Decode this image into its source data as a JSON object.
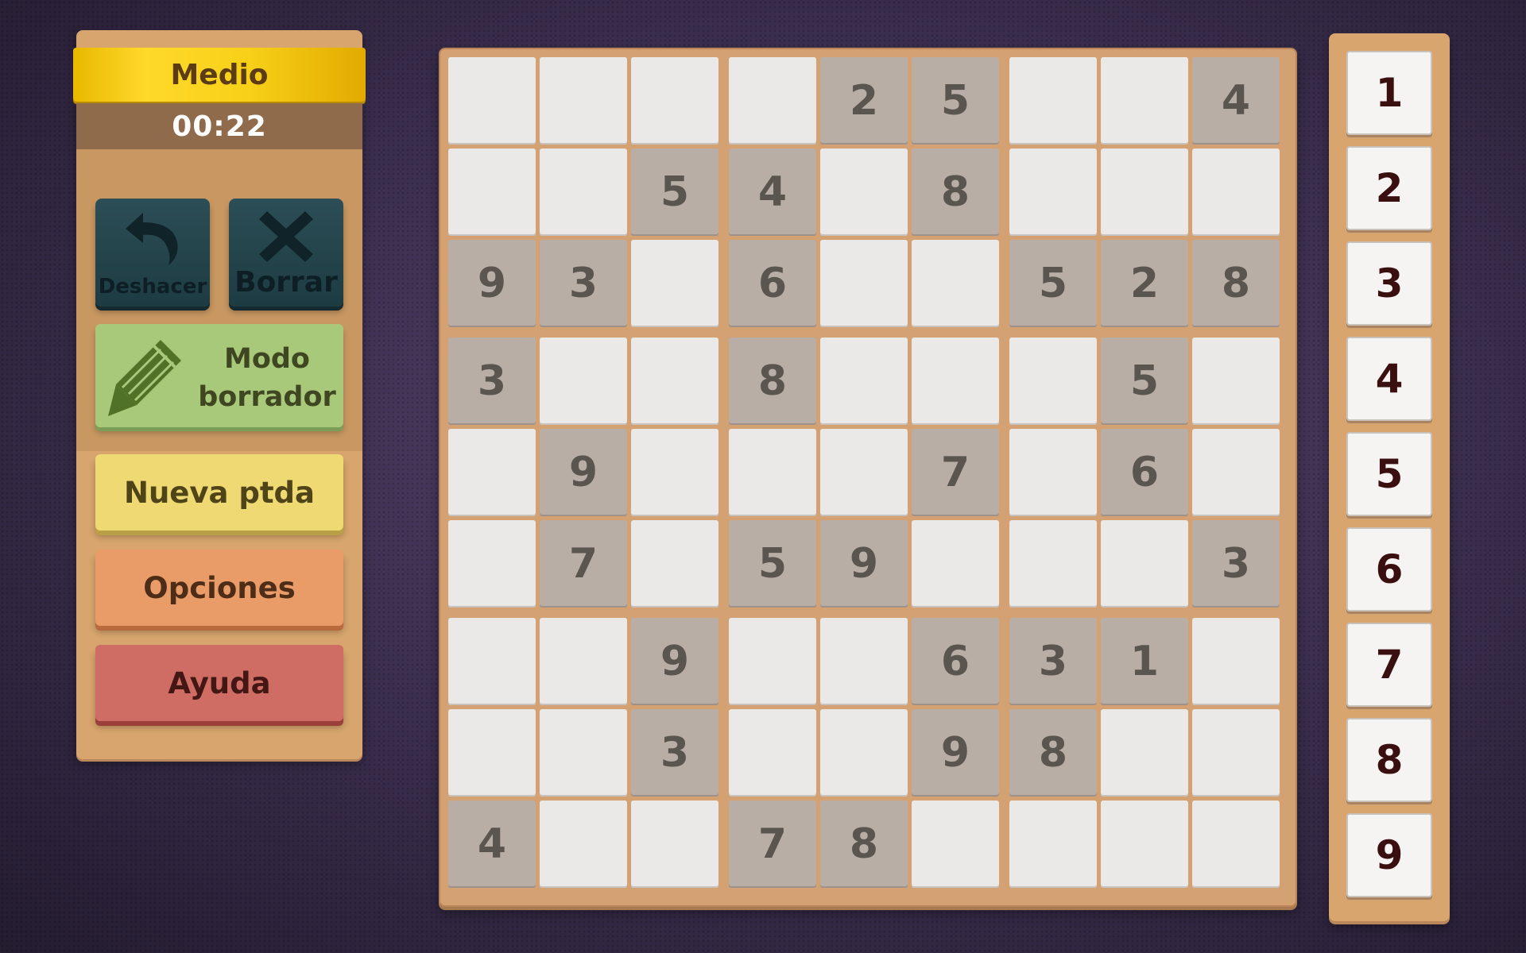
{
  "header": {
    "difficulty": "Medio",
    "timer": "00:22"
  },
  "tools": {
    "undo_label": "Deshacer",
    "undo_icon": "undo-arrow-icon",
    "clear_label": "Borrar",
    "clear_icon": "x-icon",
    "eraser_mode_line1": "Modo",
    "eraser_mode_line2": "borrador",
    "eraser_mode_icon": "pencil-icon"
  },
  "menu": {
    "new_game": "Nueva ptda",
    "options": "Opciones",
    "help": "Ayuda"
  },
  "colors": {
    "difficulty_banner": "#f7d018",
    "tool_button": "#2c4e56",
    "eraser_mode_button": "#a9c97a",
    "new_game_button": "#eed972",
    "options_button": "#ea9c68",
    "help_button": "#cf6d64",
    "given_cell": "#b9aea6",
    "empty_cell": "#ebe8e8",
    "frame": "#d7a56d"
  },
  "board": [
    [
      "",
      "",
      "",
      "",
      "2",
      "5",
      "",
      "",
      "4"
    ],
    [
      "",
      "",
      "5",
      "4",
      "",
      "8",
      "",
      "",
      ""
    ],
    [
      "9",
      "3",
      "",
      "6",
      "",
      "",
      "5",
      "2",
      "8"
    ],
    [
      "3",
      "",
      "",
      "8",
      "",
      "",
      "",
      "5",
      ""
    ],
    [
      "",
      "9",
      "",
      "",
      "",
      "7",
      "",
      "6",
      ""
    ],
    [
      "",
      "7",
      "",
      "5",
      "9",
      "",
      "",
      "",
      "3"
    ],
    [
      "",
      "",
      "9",
      "",
      "",
      "6",
      "3",
      "1",
      ""
    ],
    [
      "",
      "",
      "3",
      "",
      "",
      "9",
      "8",
      "",
      ""
    ],
    [
      "4",
      "",
      "",
      "7",
      "8",
      "",
      "",
      "",
      ""
    ]
  ],
  "number_pad": [
    "1",
    "2",
    "3",
    "4",
    "5",
    "6",
    "7",
    "8",
    "9"
  ]
}
